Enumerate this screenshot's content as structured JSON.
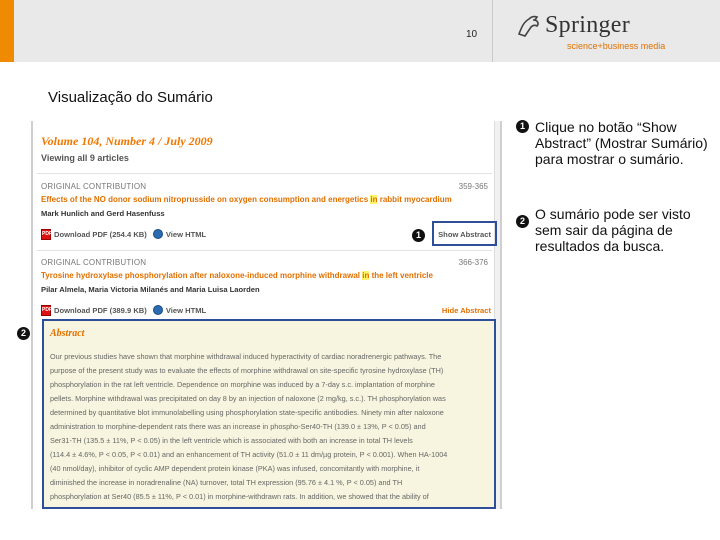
{
  "slide": {
    "page_number": "10",
    "title": "Visualização do Sumário",
    "brand": {
      "name": "Springer",
      "tagline": "science+business media",
      "accent": "#f08a00"
    }
  },
  "screenshot": {
    "issue_title": "Volume 104, Number 4 / July 2009",
    "viewing": "Viewing all 9 articles",
    "articles": [
      {
        "type": "ORIGINAL CONTRIBUTION",
        "pages": "359-365",
        "title_before": "Effects of the NO donor sodium nitroprusside on oxygen consumption and energetics ",
        "title_highlight": "in",
        "title_after": " rabbit myocardium",
        "authors": "Mark Hunlich and Gerd Hasenfuss",
        "pdf_link": "Download PDF (254.4 KB)",
        "html_link": "View HTML",
        "abstract_toggle": "Show Abstract"
      },
      {
        "type": "ORIGINAL CONTRIBUTION",
        "pages": "366-376",
        "title_before": "Tyrosine hydroxylase phosphorylation after naloxone-induced morphine withdrawal ",
        "title_highlight": "in",
        "title_after": " the left ventricle",
        "authors": "Pilar Almela, Maria Victoria Milanés and Maria Luisa Laorden",
        "pdf_link": "Download PDF (389.9 KB)",
        "html_link": "View HTML",
        "abstract_toggle": "Hide Abstract"
      }
    ],
    "abstract": {
      "heading": "Abstract",
      "lines": [
        "Our previous studies have shown that morphine withdrawal induced hyperactivity of cardiac noradrenergic pathways. The",
        "purpose of the present study was to evaluate the effects of morphine withdrawal on site-specific tyrosine hydroxylase (TH)",
        "phosphorylation in the rat left ventricle. Dependence on morphine was induced by a 7-day s.c. implantation of morphine",
        "pellets. Morphine withdrawal was precipitated on day 8 by an injection of naloxone (2 mg/kg, s.c.). TH phosphorylation was",
        "determined by quantitative blot immunolabelling using phosphorylation state-specific antibodies. Ninety min after naloxone",
        "administration to morphine-dependent rats there was an increase in phospho-Ser40-TH (139.0 ± 13%, P < 0.05) and",
        "Ser31-TH (135.5 ± 11%, P < 0.05) in the left ventricle which is associated with both an increase in total TH levels",
        "(114.4 ± 4.6%, P < 0.05, P < 0.01) and an enhancement of TH activity (51.0 ± 11 dm/µg protein, P < 0.001). When HA-1004",
        "(40 nmol/day), inhibitor of cyclic AMP dependent protein kinase (PKA) was infused, concomitantly with morphine, it",
        "diminished the increase in noradrenaline (NA) turnover, total TH expression (95.76 ± 4.1 %, P < 0.05) and TH",
        "phosphorylation at Ser40 (85.5 ± 11%, P < 0.01) in morphine-withdrawn rats. In addition, we showed that the ability of"
      ]
    }
  },
  "callouts": {
    "badge_1": "1",
    "badge_2": "2",
    "note_1": "Clique no botão “Show Abstract” (Mostrar Sumário) para mostrar o sumário.",
    "note_2": "O sumário pode ser visto sem sair da página de resultados da busca.",
    "box_color": "#2f4e9a"
  }
}
